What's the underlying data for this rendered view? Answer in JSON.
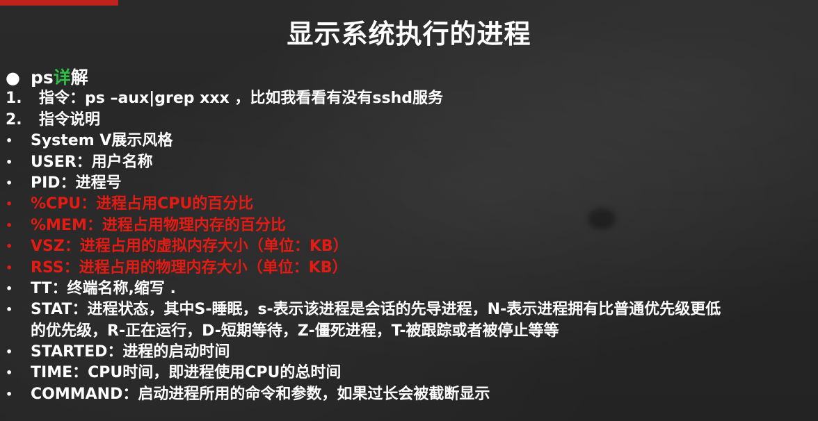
{
  "title": "显示系统执行的进程",
  "colors": {
    "accent_green": "#2fbd48",
    "emphasis_red": "#e31b13",
    "corner_tab": "#c0231d"
  },
  "heading": {
    "bullet": "●",
    "prefix": "ps",
    "accent": "详",
    "suffix": "解"
  },
  "steps": [
    {
      "number": "1.",
      "text": "指令：ps –aux|grep xxx ，比如我看看有没有sshd服务"
    },
    {
      "number": "2.",
      "text": "指令说明"
    }
  ],
  "bullet": "•",
  "items": [
    {
      "text": "System V展示风格",
      "highlight": false
    },
    {
      "text": "USER：用户名称",
      "highlight": false
    },
    {
      "text": "PID：进程号",
      "highlight": false
    },
    {
      "text": "%CPU：进程占用CPU的百分比",
      "highlight": true
    },
    {
      "text": "%MEM：进程占用物理内存的百分比",
      "highlight": true
    },
    {
      "text": "VSZ：进程占用的虚拟内存大小（单位：KB）",
      "highlight": true
    },
    {
      "text": "RSS：进程占用的物理内存大小（单位：KB）",
      "highlight": true
    },
    {
      "text": "TT：终端名称,缩写 .",
      "highlight": false
    },
    {
      "text": "STAT：进程状态，其中S-睡眠，s-表示该进程是会话的先导进程，N-表示进程拥有比普通优先级更低",
      "highlight": false
    },
    {
      "text": "的优先级，R-正在运行，D-短期等待，Z-僵死进程，T-被跟踪或者被停止等等",
      "highlight": false,
      "continuation": true
    },
    {
      "text": "STARTED：进程的启动时间",
      "highlight": false
    },
    {
      "text": "TIME：CPU时间，即进程使用CPU的总时间",
      "highlight": false
    },
    {
      "text": "COMMAND：启动进程所用的命令和参数，如果过长会被截断显示",
      "highlight": false
    }
  ]
}
